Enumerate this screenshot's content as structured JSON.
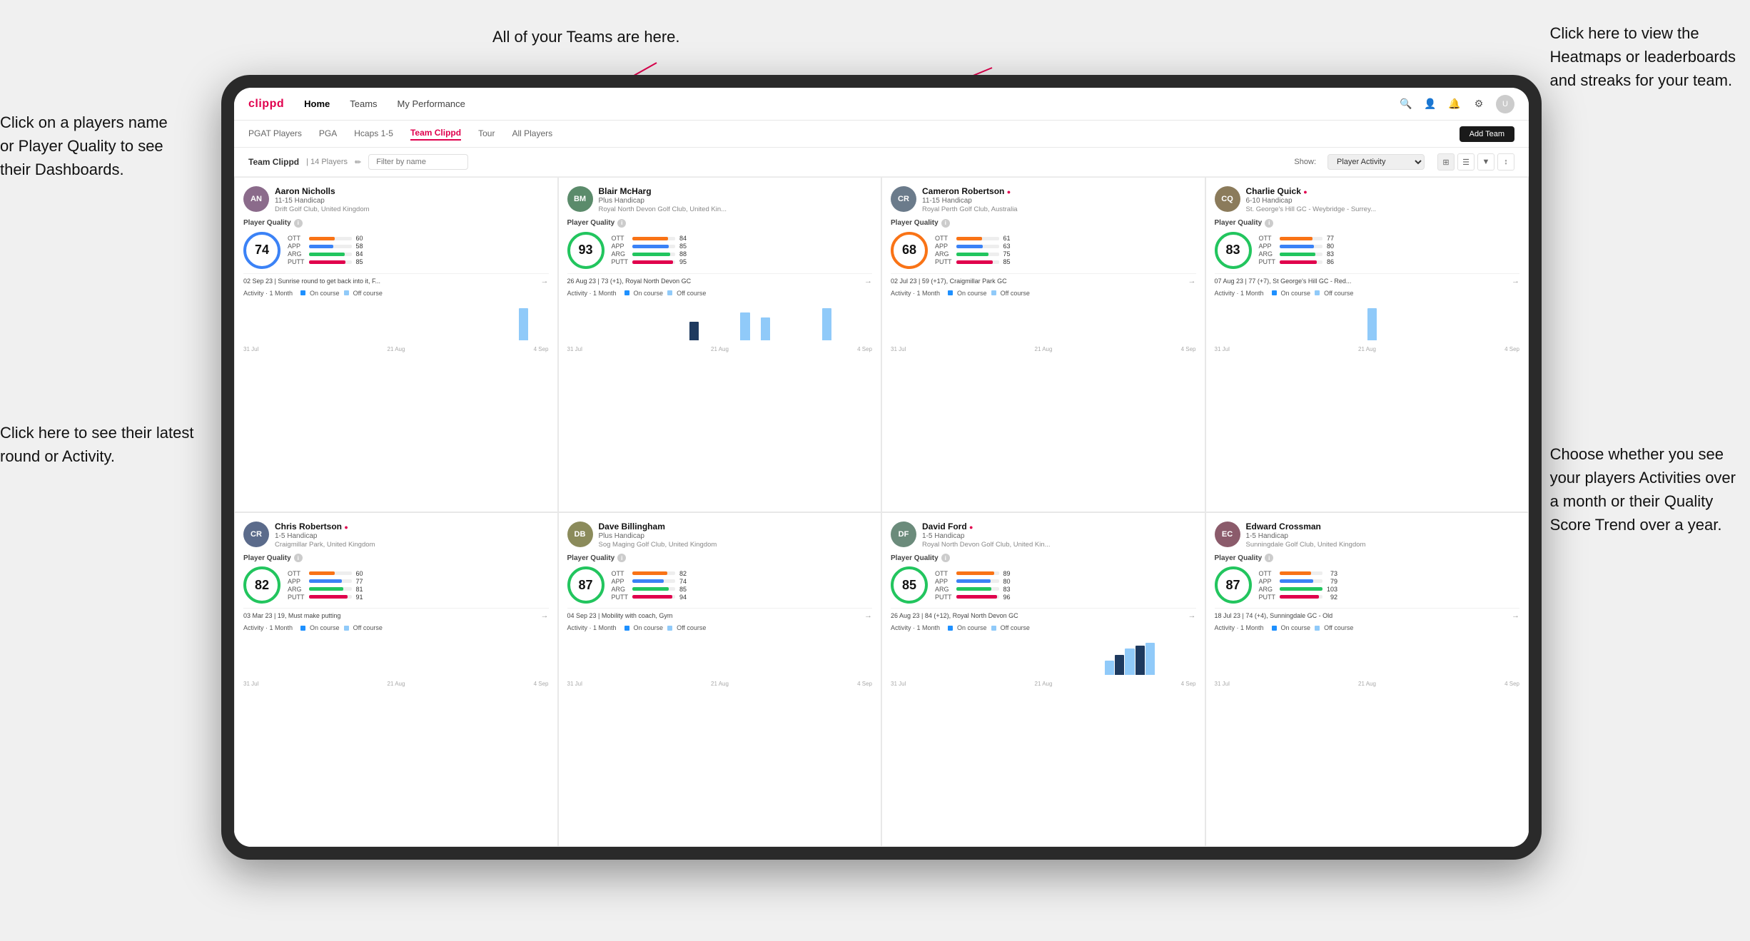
{
  "annotations": {
    "left1": "Click on a players name\nor Player Quality to see\ntheir Dashboards.",
    "left2": "Click here to see their latest\nround or Activity.",
    "top_center": "All of your Teams are here.",
    "top_right": "Click here to view the\nHeatmaps or leaderboards\nand streaks for your team.",
    "bottom_right": "Choose whether you see\nyour players Activities over\na month or their Quality\nScore Trend over a year."
  },
  "nav": {
    "logo": "clippd",
    "items": [
      "Home",
      "Teams",
      "My Performance"
    ],
    "active": "Teams"
  },
  "sub_nav": {
    "items": [
      "PGAT Players",
      "PGA",
      "Hcaps 1-5",
      "Team Clippd",
      "Tour",
      "All Players"
    ],
    "active": "Team Clippd",
    "add_button": "Add Team"
  },
  "team_header": {
    "title": "Team Clippd",
    "separator": "|",
    "count": "14 Players",
    "filter_placeholder": "Filter by name",
    "show_label": "Show:",
    "show_value": "Player Activity",
    "edit_icon": "pencil-icon"
  },
  "players": [
    {
      "name": "Aaron Nicholls",
      "handicap": "11-15 Handicap",
      "club": "Drift Golf Club, United Kingdom",
      "quality_score": 74,
      "quality_color": "blue",
      "stats": {
        "OTT": {
          "value": 60,
          "pct": 60
        },
        "APP": {
          "value": 58,
          "pct": 58
        },
        "ARG": {
          "value": 84,
          "pct": 84
        },
        "PUTT": {
          "value": 85,
          "pct": 85
        }
      },
      "last_round": "02 Sep 23 | Sunrise round to get back into it, F...",
      "activity_label": "Activity · 1 Month",
      "chart_bars": [
        0,
        0,
        0,
        0,
        0,
        0,
        0,
        0,
        0,
        0,
        0,
        0,
        0,
        0,
        0,
        0,
        0,
        0,
        0,
        0,
        0,
        0,
        0,
        0,
        0,
        0,
        0,
        5,
        0,
        0
      ],
      "chart_dates": [
        "31 Jul",
        "21 Aug",
        "4 Sep"
      ]
    },
    {
      "name": "Blair McHarg",
      "handicap": "Plus Handicap",
      "club": "Royal North Devon Golf Club, United Kin...",
      "quality_score": 93,
      "quality_color": "green",
      "stats": {
        "OTT": {
          "value": 84,
          "pct": 84
        },
        "APP": {
          "value": 85,
          "pct": 85
        },
        "ARG": {
          "value": 88,
          "pct": 88
        },
        "PUTT": {
          "value": 95,
          "pct": 95
        }
      },
      "last_round": "26 Aug 23 | 73 (+1), Royal North Devon GC",
      "activity_label": "Activity · 1 Month",
      "chart_bars": [
        0,
        0,
        0,
        0,
        0,
        0,
        0,
        0,
        0,
        0,
        0,
        0,
        8,
        0,
        0,
        0,
        0,
        12,
        0,
        10,
        0,
        0,
        0,
        0,
        0,
        14,
        0,
        0,
        0,
        0
      ],
      "chart_dates": [
        "31 Jul",
        "21 Aug",
        "4 Sep"
      ]
    },
    {
      "name": "Cameron Robertson",
      "verified": true,
      "handicap": "11-15 Handicap",
      "club": "Royal Perth Golf Club, Australia",
      "quality_score": 68,
      "quality_color": "orange",
      "stats": {
        "OTT": {
          "value": 61,
          "pct": 61
        },
        "APP": {
          "value": 63,
          "pct": 63
        },
        "ARG": {
          "value": 75,
          "pct": 75
        },
        "PUTT": {
          "value": 85,
          "pct": 85
        }
      },
      "last_round": "02 Jul 23 | 59 (+17), Craigmillar Park GC",
      "activity_label": "Activity · 1 Month",
      "chart_bars": [
        0,
        0,
        0,
        0,
        0,
        0,
        0,
        0,
        0,
        0,
        0,
        0,
        0,
        0,
        0,
        0,
        0,
        0,
        0,
        0,
        0,
        0,
        0,
        0,
        0,
        0,
        0,
        0,
        0,
        0
      ],
      "chart_dates": [
        "31 Jul",
        "21 Aug",
        "4 Sep"
      ]
    },
    {
      "name": "Charlie Quick",
      "verified": true,
      "handicap": "6-10 Handicap",
      "club": "St. George's Hill GC - Weybridge - Surrey...",
      "quality_score": 83,
      "quality_color": "green",
      "stats": {
        "OTT": {
          "value": 77,
          "pct": 77
        },
        "APP": {
          "value": 80,
          "pct": 80
        },
        "ARG": {
          "value": 83,
          "pct": 83
        },
        "PUTT": {
          "value": 86,
          "pct": 86
        }
      },
      "last_round": "07 Aug 23 | 77 (+7), St George's Hill GC - Red...",
      "activity_label": "Activity · 1 Month",
      "chart_bars": [
        0,
        0,
        0,
        0,
        0,
        0,
        0,
        0,
        0,
        0,
        0,
        0,
        0,
        0,
        0,
        6,
        0,
        0,
        0,
        0,
        0,
        0,
        0,
        0,
        0,
        0,
        0,
        0,
        0,
        0
      ],
      "chart_dates": [
        "31 Jul",
        "21 Aug",
        "4 Sep"
      ]
    },
    {
      "name": "Chris Robertson",
      "verified": true,
      "handicap": "1-5 Handicap",
      "club": "Craigmillar Park, United Kingdom",
      "quality_score": 82,
      "quality_color": "green",
      "stats": {
        "OTT": {
          "value": 60,
          "pct": 60
        },
        "APP": {
          "value": 77,
          "pct": 77
        },
        "ARG": {
          "value": 81,
          "pct": 81
        },
        "PUTT": {
          "value": 91,
          "pct": 91
        }
      },
      "last_round": "03 Mar 23 | 19, Must make putting",
      "activity_label": "Activity · 1 Month",
      "chart_bars": [
        0,
        0,
        0,
        0,
        0,
        0,
        0,
        0,
        0,
        0,
        0,
        0,
        0,
        0,
        0,
        0,
        0,
        0,
        0,
        0,
        0,
        0,
        0,
        0,
        0,
        0,
        0,
        0,
        0,
        0
      ],
      "chart_dates": [
        "31 Jul",
        "21 Aug",
        "4 Sep"
      ]
    },
    {
      "name": "Dave Billingham",
      "handicap": "Plus Handicap",
      "club": "Sog Maging Golf Club, United Kingdom",
      "quality_score": 87,
      "quality_color": "green",
      "stats": {
        "OTT": {
          "value": 82,
          "pct": 82
        },
        "APP": {
          "value": 74,
          "pct": 74
        },
        "ARG": {
          "value": 85,
          "pct": 85
        },
        "PUTT": {
          "value": 94,
          "pct": 94
        }
      },
      "last_round": "04 Sep 23 | Mobility with coach, Gym",
      "activity_label": "Activity · 1 Month",
      "chart_bars": [
        0,
        0,
        0,
        0,
        0,
        0,
        0,
        0,
        0,
        0,
        0,
        0,
        0,
        0,
        0,
        0,
        0,
        0,
        0,
        0,
        0,
        0,
        0,
        0,
        0,
        0,
        0,
        0,
        0,
        0
      ],
      "chart_dates": [
        "31 Jul",
        "21 Aug",
        "4 Sep"
      ]
    },
    {
      "name": "David Ford",
      "verified": true,
      "handicap": "1-5 Handicap",
      "club": "Royal North Devon Golf Club, United Kin...",
      "quality_score": 85,
      "quality_color": "green",
      "stats": {
        "OTT": {
          "value": 89,
          "pct": 89
        },
        "APP": {
          "value": 80,
          "pct": 80
        },
        "ARG": {
          "value": 83,
          "pct": 83
        },
        "PUTT": {
          "value": 96,
          "pct": 96
        }
      },
      "last_round": "26 Aug 23 | 84 (+12), Royal North Devon GC",
      "activity_label": "Activity · 1 Month",
      "chart_bars": [
        0,
        0,
        0,
        0,
        0,
        0,
        0,
        0,
        0,
        0,
        0,
        0,
        0,
        0,
        0,
        0,
        0,
        0,
        0,
        0,
        0,
        10,
        14,
        18,
        20,
        22,
        0,
        0,
        0,
        0
      ],
      "chart_dates": [
        "31 Jul",
        "21 Aug",
        "4 Sep"
      ]
    },
    {
      "name": "Edward Crossman",
      "handicap": "1-5 Handicap",
      "club": "Sunningdale Golf Club, United Kingdom",
      "quality_score": 87,
      "quality_color": "green",
      "stats": {
        "OTT": {
          "value": 73,
          "pct": 73
        },
        "APP": {
          "value": 79,
          "pct": 79
        },
        "ARG": {
          "value": 103,
          "pct": 100
        },
        "PUTT": {
          "value": 92,
          "pct": 92
        }
      },
      "last_round": "18 Jul 23 | 74 (+4), Sunningdale GC - Old",
      "activity_label": "Activity · 1 Month",
      "chart_bars": [
        0,
        0,
        0,
        0,
        0,
        0,
        0,
        0,
        0,
        0,
        0,
        0,
        0,
        0,
        0,
        0,
        0,
        0,
        0,
        0,
        0,
        0,
        0,
        0,
        0,
        0,
        0,
        0,
        0,
        0
      ],
      "chart_dates": [
        "31 Jul",
        "21 Aug",
        "4 Sep"
      ]
    }
  ]
}
